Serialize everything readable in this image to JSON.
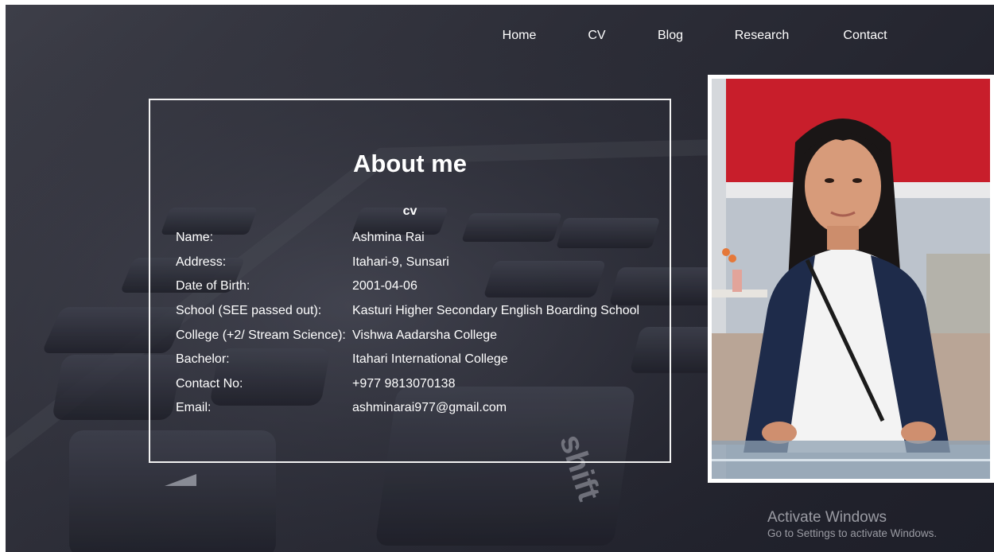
{
  "nav": {
    "items": [
      {
        "label": "Home"
      },
      {
        "label": "CV"
      },
      {
        "label": "Blog"
      },
      {
        "label": "Research"
      },
      {
        "label": "Contact"
      }
    ]
  },
  "about": {
    "title": "About me",
    "subtitle": "cv",
    "rows": [
      {
        "label": "Name:",
        "value": "Ashmina Rai"
      },
      {
        "label": "Address:",
        "value": "Itahari-9, Sunsari"
      },
      {
        "label": "Date of Birth:",
        "value": "2001-04-06"
      },
      {
        "label": "School (SEE passed out):",
        "value": "Kasturi Higher Secondary English Boarding School"
      },
      {
        "label": "College (+2/ Stream Science):",
        "value": "Vishwa Aadarsha College"
      },
      {
        "label": "Bachelor:",
        "value": "Itahari International College"
      },
      {
        "label": "Contact No:",
        "value": "+977 9813070138"
      },
      {
        "label": "Email:",
        "value": "ashminarai977@gmail.com"
      }
    ]
  },
  "watermark": {
    "title": "Activate Windows",
    "subtitle": "Go to Settings to activate Windows."
  },
  "colors": {
    "background": "#2c2d37",
    "text": "#ffffff",
    "border": "#f2f2f2",
    "photo_wall": "#c81e2b"
  }
}
